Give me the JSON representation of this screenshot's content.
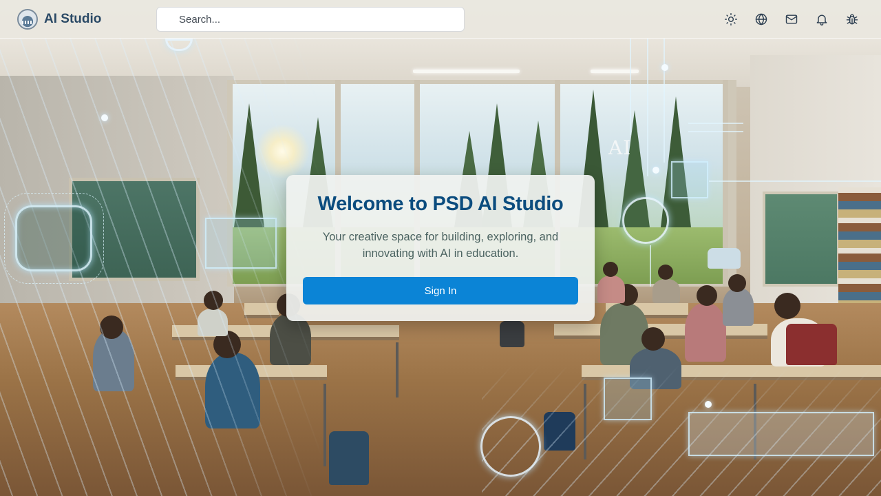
{
  "header": {
    "app_title": "AI Studio",
    "search": {
      "placeholder": "Search...",
      "value": ""
    },
    "icons": [
      "sun-icon",
      "globe-icon",
      "mail-icon",
      "bell-icon",
      "bug-icon"
    ]
  },
  "background": {
    "overlay_text": "AI"
  },
  "welcome": {
    "title": "Welcome to PSD AI Studio",
    "subtitle": "Your creative space for building, exploring, and innovating with AI in education.",
    "sign_in_label": "Sign In"
  },
  "colors": {
    "title": "#0b4c7e",
    "button": "#0b84d6",
    "header_text": "#2b4a66"
  }
}
